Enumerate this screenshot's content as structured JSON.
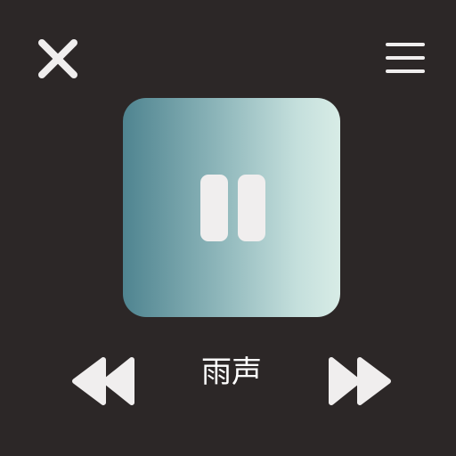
{
  "player": {
    "track_title": "雨声",
    "state": "playing"
  },
  "icons": {
    "close": "close-icon",
    "menu": "hamburger-menu-icon",
    "pause": "pause-icon",
    "previous": "rewind-icon",
    "next": "fast-forward-icon"
  },
  "colors": {
    "background": "#2c2727",
    "icon": "#f0eeee",
    "cover_gradient_start": "#4f8490",
    "cover_gradient_end": "#d8ece6"
  }
}
